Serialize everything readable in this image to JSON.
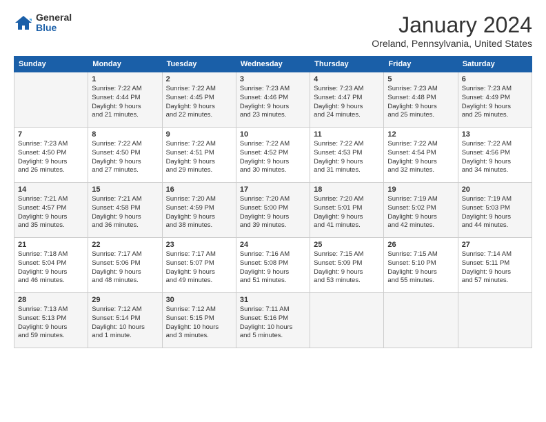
{
  "logo": {
    "general": "General",
    "blue": "Blue"
  },
  "header": {
    "month_title": "January 2024",
    "location": "Oreland, Pennsylvania, United States"
  },
  "weekdays": [
    "Sunday",
    "Monday",
    "Tuesday",
    "Wednesday",
    "Thursday",
    "Friday",
    "Saturday"
  ],
  "weeks": [
    [
      {
        "day": "",
        "info": ""
      },
      {
        "day": "1",
        "info": "Sunrise: 7:22 AM\nSunset: 4:44 PM\nDaylight: 9 hours\nand 21 minutes."
      },
      {
        "day": "2",
        "info": "Sunrise: 7:22 AM\nSunset: 4:45 PM\nDaylight: 9 hours\nand 22 minutes."
      },
      {
        "day": "3",
        "info": "Sunrise: 7:23 AM\nSunset: 4:46 PM\nDaylight: 9 hours\nand 23 minutes."
      },
      {
        "day": "4",
        "info": "Sunrise: 7:23 AM\nSunset: 4:47 PM\nDaylight: 9 hours\nand 24 minutes."
      },
      {
        "day": "5",
        "info": "Sunrise: 7:23 AM\nSunset: 4:48 PM\nDaylight: 9 hours\nand 25 minutes."
      },
      {
        "day": "6",
        "info": "Sunrise: 7:23 AM\nSunset: 4:49 PM\nDaylight: 9 hours\nand 25 minutes."
      }
    ],
    [
      {
        "day": "7",
        "info": "Sunrise: 7:23 AM\nSunset: 4:50 PM\nDaylight: 9 hours\nand 26 minutes."
      },
      {
        "day": "8",
        "info": "Sunrise: 7:22 AM\nSunset: 4:50 PM\nDaylight: 9 hours\nand 27 minutes."
      },
      {
        "day": "9",
        "info": "Sunrise: 7:22 AM\nSunset: 4:51 PM\nDaylight: 9 hours\nand 29 minutes."
      },
      {
        "day": "10",
        "info": "Sunrise: 7:22 AM\nSunset: 4:52 PM\nDaylight: 9 hours\nand 30 minutes."
      },
      {
        "day": "11",
        "info": "Sunrise: 7:22 AM\nSunset: 4:53 PM\nDaylight: 9 hours\nand 31 minutes."
      },
      {
        "day": "12",
        "info": "Sunrise: 7:22 AM\nSunset: 4:54 PM\nDaylight: 9 hours\nand 32 minutes."
      },
      {
        "day": "13",
        "info": "Sunrise: 7:22 AM\nSunset: 4:56 PM\nDaylight: 9 hours\nand 34 minutes."
      }
    ],
    [
      {
        "day": "14",
        "info": "Sunrise: 7:21 AM\nSunset: 4:57 PM\nDaylight: 9 hours\nand 35 minutes."
      },
      {
        "day": "15",
        "info": "Sunrise: 7:21 AM\nSunset: 4:58 PM\nDaylight: 9 hours\nand 36 minutes."
      },
      {
        "day": "16",
        "info": "Sunrise: 7:20 AM\nSunset: 4:59 PM\nDaylight: 9 hours\nand 38 minutes."
      },
      {
        "day": "17",
        "info": "Sunrise: 7:20 AM\nSunset: 5:00 PM\nDaylight: 9 hours\nand 39 minutes."
      },
      {
        "day": "18",
        "info": "Sunrise: 7:20 AM\nSunset: 5:01 PM\nDaylight: 9 hours\nand 41 minutes."
      },
      {
        "day": "19",
        "info": "Sunrise: 7:19 AM\nSunset: 5:02 PM\nDaylight: 9 hours\nand 42 minutes."
      },
      {
        "day": "20",
        "info": "Sunrise: 7:19 AM\nSunset: 5:03 PM\nDaylight: 9 hours\nand 44 minutes."
      }
    ],
    [
      {
        "day": "21",
        "info": "Sunrise: 7:18 AM\nSunset: 5:04 PM\nDaylight: 9 hours\nand 46 minutes."
      },
      {
        "day": "22",
        "info": "Sunrise: 7:17 AM\nSunset: 5:06 PM\nDaylight: 9 hours\nand 48 minutes."
      },
      {
        "day": "23",
        "info": "Sunrise: 7:17 AM\nSunset: 5:07 PM\nDaylight: 9 hours\nand 49 minutes."
      },
      {
        "day": "24",
        "info": "Sunrise: 7:16 AM\nSunset: 5:08 PM\nDaylight: 9 hours\nand 51 minutes."
      },
      {
        "day": "25",
        "info": "Sunrise: 7:15 AM\nSunset: 5:09 PM\nDaylight: 9 hours\nand 53 minutes."
      },
      {
        "day": "26",
        "info": "Sunrise: 7:15 AM\nSunset: 5:10 PM\nDaylight: 9 hours\nand 55 minutes."
      },
      {
        "day": "27",
        "info": "Sunrise: 7:14 AM\nSunset: 5:11 PM\nDaylight: 9 hours\nand 57 minutes."
      }
    ],
    [
      {
        "day": "28",
        "info": "Sunrise: 7:13 AM\nSunset: 5:13 PM\nDaylight: 9 hours\nand 59 minutes."
      },
      {
        "day": "29",
        "info": "Sunrise: 7:12 AM\nSunset: 5:14 PM\nDaylight: 10 hours\nand 1 minute."
      },
      {
        "day": "30",
        "info": "Sunrise: 7:12 AM\nSunset: 5:15 PM\nDaylight: 10 hours\nand 3 minutes."
      },
      {
        "day": "31",
        "info": "Sunrise: 7:11 AM\nSunset: 5:16 PM\nDaylight: 10 hours\nand 5 minutes."
      },
      {
        "day": "",
        "info": ""
      },
      {
        "day": "",
        "info": ""
      },
      {
        "day": "",
        "info": ""
      }
    ]
  ]
}
